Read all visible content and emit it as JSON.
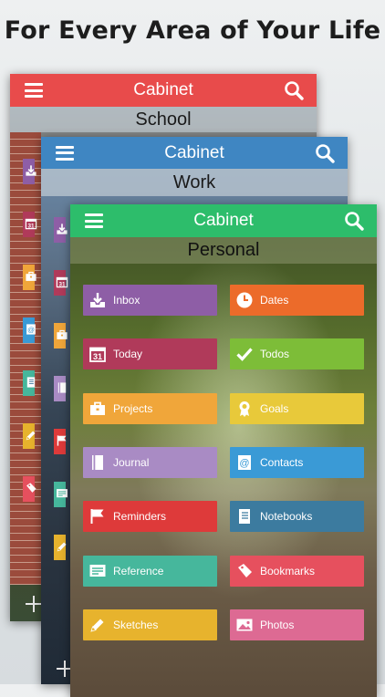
{
  "headline": "For Every Area of Your Life",
  "app_title": "Cabinet",
  "cards": {
    "school": {
      "title": "Cabinet",
      "subtitle": "School",
      "accent": "#e84b4b"
    },
    "work": {
      "title": "Cabinet",
      "subtitle": "Work",
      "accent": "#3f86c2"
    },
    "personal": {
      "title": "Cabinet",
      "subtitle": "Personal",
      "accent": "#2dbd6b"
    }
  },
  "categories": [
    {
      "label": "Inbox",
      "icon": "inbox-icon",
      "color": "#8e5ea6"
    },
    {
      "label": "Dates",
      "icon": "clock-icon",
      "color": "#ec6b2a"
    },
    {
      "label": "Today",
      "icon": "calendar-31-icon",
      "color": "#b03a5a"
    },
    {
      "label": "Todos",
      "icon": "checkmark-icon",
      "color": "#7dbd38"
    },
    {
      "label": "Projects",
      "icon": "briefcase-icon",
      "color": "#f0a63a"
    },
    {
      "label": "Goals",
      "icon": "award-ribbon-icon",
      "color": "#e8c93a"
    },
    {
      "label": "Journal",
      "icon": "journal-book-icon",
      "color": "#a98bc4"
    },
    {
      "label": "Contacts",
      "icon": "at-sign-icon",
      "color": "#3a9ad6"
    },
    {
      "label": "Reminders",
      "icon": "flag-icon",
      "color": "#de3a3a"
    },
    {
      "label": "Notebooks",
      "icon": "notebook-icon",
      "color": "#3c7b9f"
    },
    {
      "label": "Reference",
      "icon": "reference-icon",
      "color": "#46b79c"
    },
    {
      "label": "Bookmarks",
      "icon": "bookmark-icon",
      "color": "#e6505e"
    },
    {
      "label": "Sketches",
      "icon": "pencil-icon",
      "color": "#e7b32d"
    },
    {
      "label": "Photos",
      "icon": "photo-icon",
      "color": "#dd6a93"
    }
  ],
  "school_side_tiles": [
    {
      "icon": "inbox-icon",
      "color": "#8e5ea6"
    },
    {
      "icon": "calendar-31-icon",
      "color": "#b03a5a"
    },
    {
      "icon": "briefcase-icon",
      "color": "#f0a63a"
    },
    {
      "icon": "at-sign-icon",
      "color": "#3a9ad6"
    },
    {
      "icon": "notebook-icon",
      "color": "#46b79c"
    },
    {
      "icon": "pencil-icon",
      "color": "#e7b32d"
    },
    {
      "icon": "bookmark-icon",
      "color": "#e6505e"
    }
  ],
  "work_side_tiles": [
    {
      "icon": "inbox-icon",
      "color": "#8e5ea6"
    },
    {
      "icon": "calendar-31-icon",
      "color": "#b03a5a"
    },
    {
      "icon": "briefcase-icon",
      "color": "#f0a63a"
    },
    {
      "icon": "journal-book-icon",
      "color": "#a98bc4"
    },
    {
      "icon": "flag-icon",
      "color": "#de3a3a"
    },
    {
      "icon": "reference-icon",
      "color": "#46b79c"
    },
    {
      "icon": "pencil-icon",
      "color": "#e7b32d"
    }
  ]
}
